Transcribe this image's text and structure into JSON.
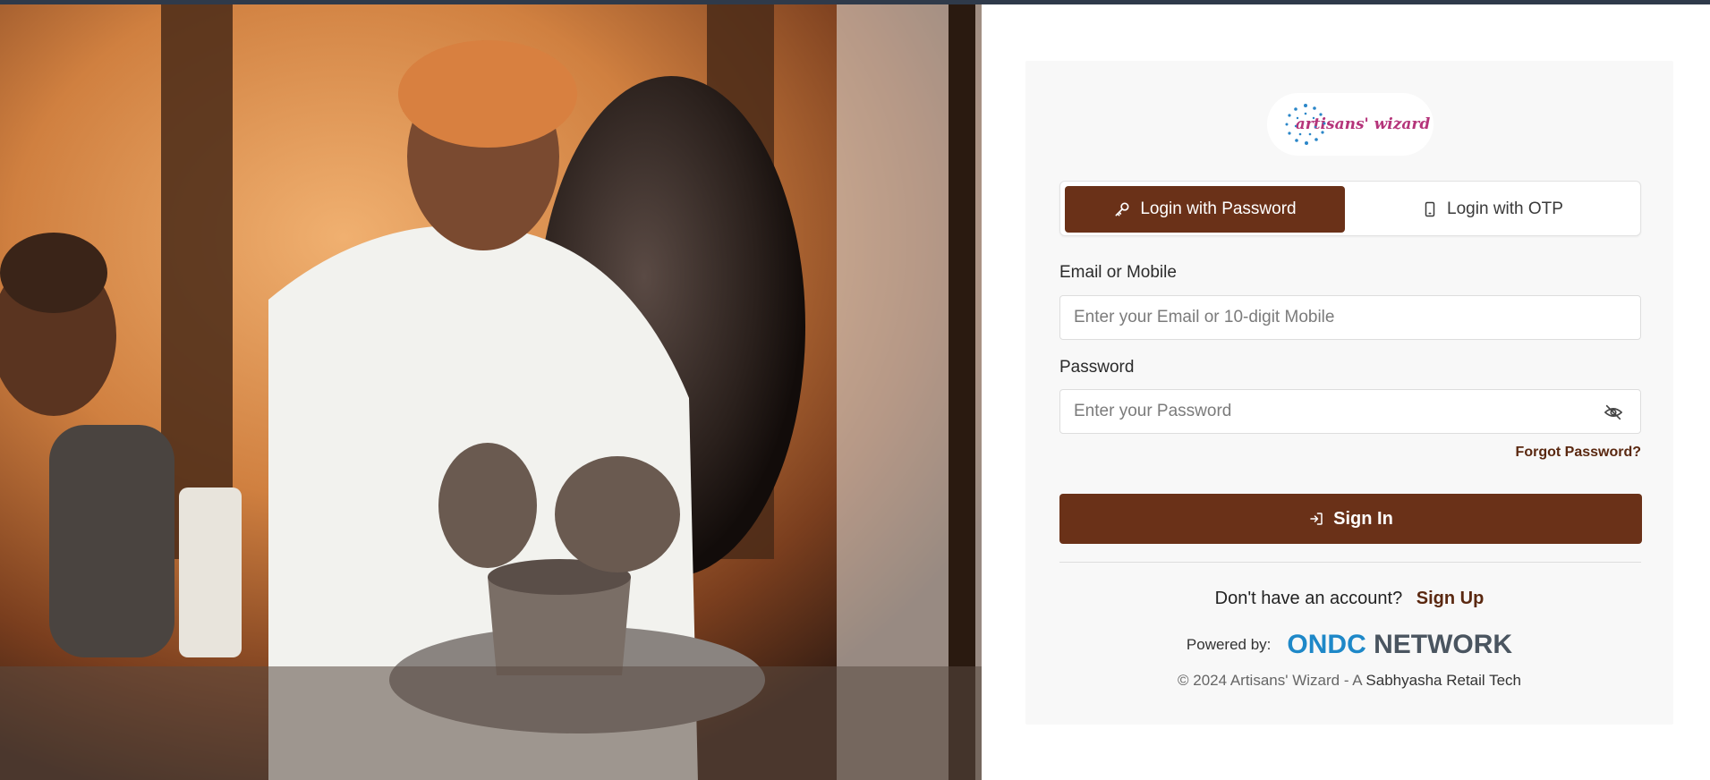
{
  "hero": {
    "alt": "Potter shaping clay on a wheel"
  },
  "logo": {
    "text": "artisans' wizard"
  },
  "tabs": [
    {
      "label": "Login with Password",
      "icon": "key-icon",
      "active": true
    },
    {
      "label": "Login with OTP",
      "icon": "mobile-icon",
      "active": false
    }
  ],
  "form": {
    "email_label": "Email or Mobile",
    "email_placeholder": "Enter your Email or 10-digit Mobile",
    "password_label": "Password",
    "password_placeholder": "Enter your Password",
    "forgot_label": "Forgot Password?",
    "signin_label": "Sign In"
  },
  "footer": {
    "account_prompt": "Don't have an account?",
    "signup_label": "Sign Up",
    "powered_label": "Powered by:",
    "ondc_brand_1": "ONDC",
    "ondc_brand_2": "NETWORK",
    "copyright_prefix": "© 2024 Artisans' Wizard - A",
    "copyright_company": "Sabhyasha Retail Tech"
  },
  "colors": {
    "primary": "#6a3118",
    "topbar": "#2f3a4a",
    "panel_bg": "#f8f8f8",
    "ondc_blue": "#1e88c8",
    "ondc_grey": "#4a5560",
    "logo_pink": "#b5347a"
  }
}
